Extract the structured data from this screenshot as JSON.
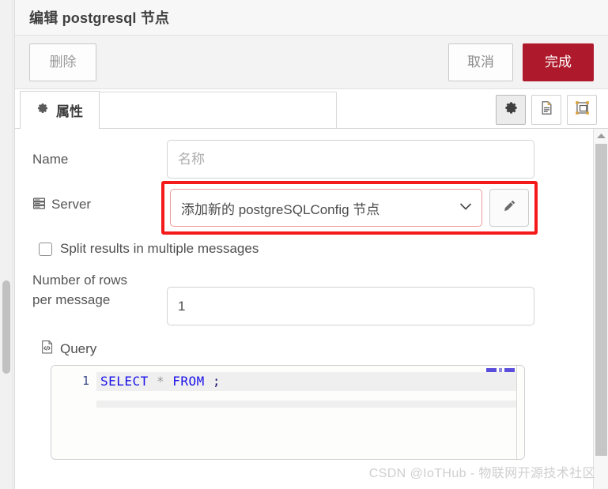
{
  "window": {
    "title": "编辑 postgresql 节点"
  },
  "toolbar": {
    "delete_label": "删除",
    "cancel_label": "取消",
    "done_label": "完成",
    "done_color": "#ae1a2b"
  },
  "tabs": {
    "items": [
      {
        "label": "属性",
        "icon": "gear-icon",
        "active": true
      }
    ],
    "icon_buttons": [
      {
        "name": "properties-gear-icon",
        "pressed": true
      },
      {
        "name": "description-document-icon",
        "pressed": false
      },
      {
        "name": "appearance-layout-icon",
        "pressed": false
      }
    ]
  },
  "form": {
    "name": {
      "label": "Name",
      "value": "",
      "placeholder": "名称"
    },
    "server": {
      "label": "Server",
      "icon": "database-server-icon",
      "selected_option": "添加新的 postgreSQLConfig 节点",
      "edit_icon": "pencil-icon",
      "annotation_color": "#f41a1a",
      "highlighted": true
    },
    "split_results": {
      "label": "Split results in multiple messages",
      "checked": false
    },
    "rows_per_message": {
      "label_line1": "Number of rows",
      "label_line2": "per message",
      "value": "1"
    },
    "query": {
      "label": "Query",
      "icon": "file-code-icon",
      "line_number": "1",
      "code_keyword_1": "SELECT",
      "code_star": "*",
      "code_keyword_2": "FROM",
      "code_semicolon": ";",
      "full_text": "SELECT * FROM ;"
    }
  },
  "watermark": {
    "text": "CSDN @IoTHub - 物联网开源技术社区"
  }
}
